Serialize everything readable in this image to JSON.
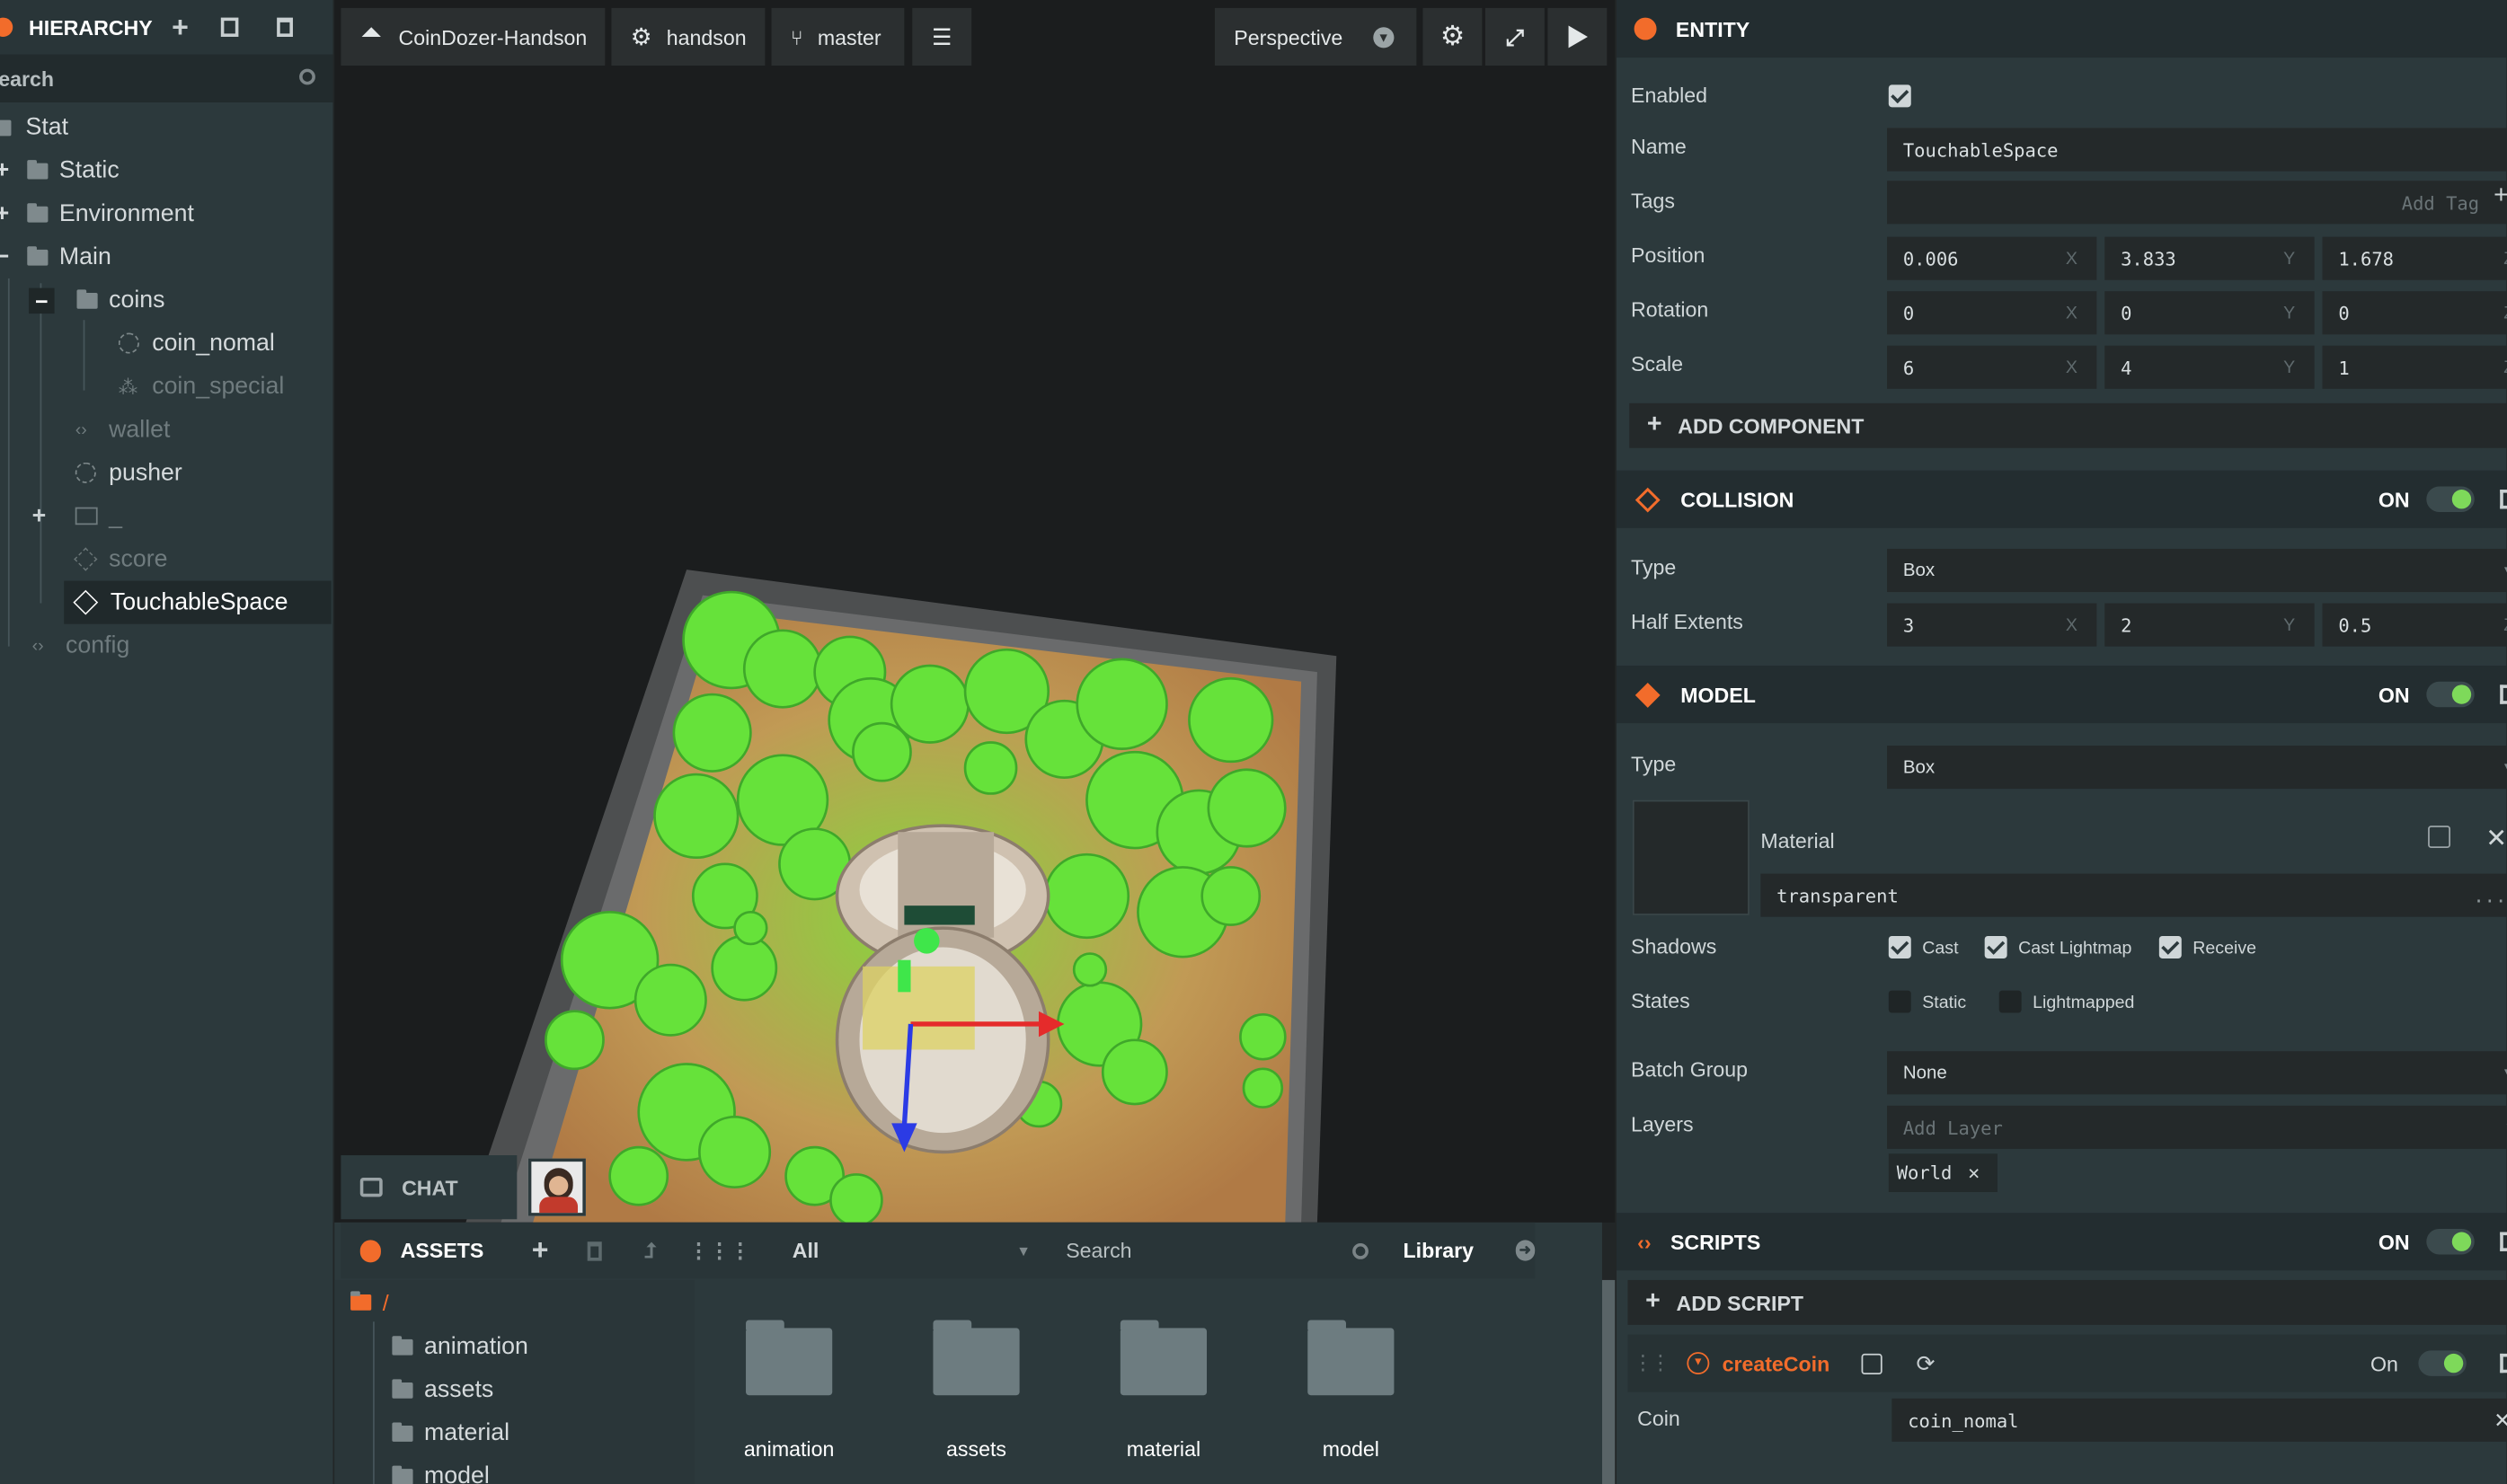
{
  "hierarchy": {
    "title": "HIERARCHY",
    "search_placeholder": "earch",
    "items": [
      {
        "label": "Stat"
      },
      {
        "label": "Static"
      },
      {
        "label": "Environment"
      },
      {
        "label": "Main"
      },
      {
        "label": "coins"
      },
      {
        "label": "coin_nomal"
      },
      {
        "label": "coin_special"
      },
      {
        "label": "wallet"
      },
      {
        "label": "pusher"
      },
      {
        "label": "_"
      },
      {
        "label": "score"
      },
      {
        "label": "TouchableSpace"
      },
      {
        "label": "config"
      }
    ]
  },
  "toolbar": {
    "project": "CoinDozer-Handson",
    "settings": "handson",
    "branch": "master",
    "camera": "Perspective"
  },
  "chat": {
    "label": "CHAT"
  },
  "assets": {
    "title": "ASSETS",
    "filter": "All",
    "search_placeholder": "Search",
    "library": "Library",
    "root": "/",
    "folders": [
      "animation",
      "assets",
      "material",
      "model"
    ],
    "tiles": [
      "animation",
      "assets",
      "material",
      "model"
    ]
  },
  "entity": {
    "title": "ENTITY",
    "enabled_label": "Enabled",
    "name_label": "Name",
    "name_value": "TouchableSpace",
    "tags_label": "Tags",
    "tags_placeholder": "Add Tag",
    "position_label": "Position",
    "position": [
      "0.006",
      "3.833",
      "1.678"
    ],
    "rotation_label": "Rotation",
    "rotation": [
      "0",
      "0",
      "0"
    ],
    "scale_label": "Scale",
    "scale": [
      "6",
      "4",
      "1"
    ],
    "axis": [
      "X",
      "Y",
      "Z"
    ],
    "add_component": "ADD COMPONENT"
  },
  "collision": {
    "title": "COLLISION",
    "state": "ON",
    "type_label": "Type",
    "type_value": "Box",
    "half_extents_label": "Half Extents",
    "half_extents": [
      "3",
      "2",
      "0.5"
    ]
  },
  "model": {
    "title": "MODEL",
    "state": "ON",
    "type_label": "Type",
    "type_value": "Box",
    "material_label": "Material",
    "material_value": "transparent",
    "material_more": "...",
    "shadows_label": "Shadows",
    "cast": "Cast",
    "cast_lightmap": "Cast Lightmap",
    "receive": "Receive",
    "states_label": "States",
    "static": "Static",
    "lightmapped": "Lightmapped",
    "batch_label": "Batch Group",
    "batch_value": "None",
    "layers_label": "Layers",
    "layers_placeholder": "Add Layer",
    "layer_tag": "World"
  },
  "scripts": {
    "title": "SCRIPTS",
    "state": "ON",
    "add_script": "ADD SCRIPT",
    "script_name": "createCoin",
    "script_state": "On",
    "attr_label": "Coin",
    "attr_value": "coin_nomal"
  },
  "colors": {
    "accent": "#f26c2b",
    "toggle_on": "#7ed95a",
    "panel": "#2c393c"
  }
}
